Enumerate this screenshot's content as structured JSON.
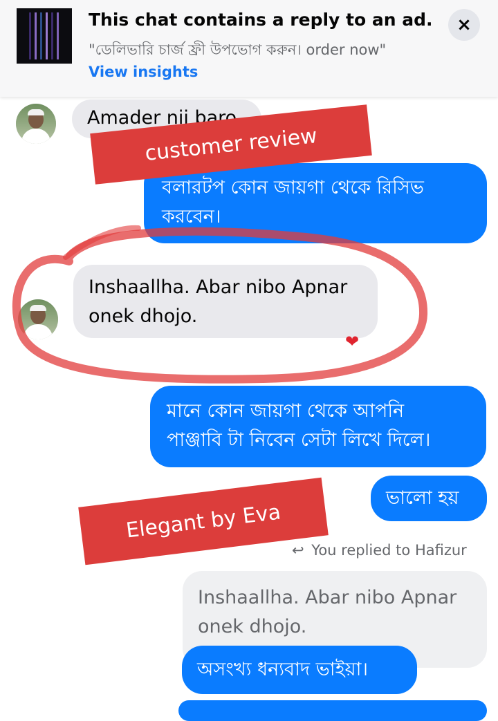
{
  "ad_banner": {
    "title": "This chat contains a reply to an ad.",
    "quote": "\"ডেলিভারি চার্জ ফ্রী উপভোগ করুন। order now\"",
    "link": "View insights",
    "close_icon": "×"
  },
  "messages": {
    "m1": "Amader nii baro",
    "m2_line1": "বলারটপ কোন জায়গা থেকে রিসিভ",
    "m2_line2": "করবেন।",
    "m3_line1": "Inshaallha. Abar nibo Apnar",
    "m3_line2": "onek dhojo.",
    "reaction": "❤",
    "m4_line1": "মানে কোন জায়গা থেকে আপনি",
    "m4_line2": "পাঞ্জাবি টা নিবেন সেটা লিখে দিলে।",
    "m5": "ভালো হয়",
    "replied_label": "You replied to Hafizur",
    "reply_icon": "↩",
    "quoted_line1": "Inshaallha. Abar nibo Apnar",
    "quoted_line2": "onek dhojo.",
    "m6": "অসংখ্য ধন্যবাদ ভাইয়া।"
  },
  "annotations": {
    "stamp1": "customer review",
    "stamp2": "Elegant by Eva",
    "stamp_color": "#dc3d3b"
  },
  "colors": {
    "outgoing_bubble": "#0a7cff",
    "incoming_bubble": "#e9e9ed",
    "link": "#1877f2"
  }
}
